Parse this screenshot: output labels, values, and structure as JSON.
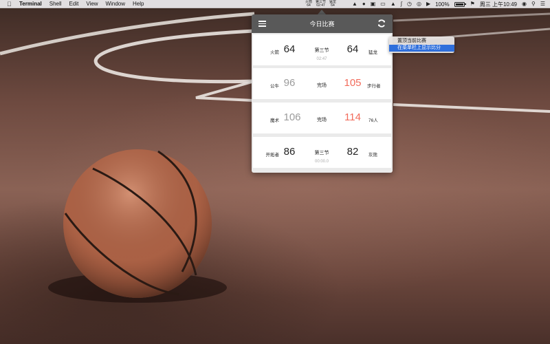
{
  "menubar": {
    "apple_icon": "apple-icon",
    "app_name": "Terminal",
    "menus": [
      "Shell",
      "Edit",
      "View",
      "Window",
      "Help"
    ],
    "mini_score": {
      "home_team": "火箭",
      "home_score": "64",
      "period": "第三节",
      "clock": "02:47",
      "away_team": "猛龙",
      "away_score": "64"
    },
    "battery_percent": "100%",
    "datetime": "周三 上午10:49"
  },
  "popover": {
    "title": "今日比赛",
    "menu_icon": "hamburger-menu-icon",
    "refresh_icon": "refresh-icon",
    "games": [
      {
        "home_team": "火箭",
        "home_score": "64",
        "state": "第三节",
        "clock": "02:47",
        "away_score": "64",
        "away_team": "猛龙"
      },
      {
        "home_team": "公牛",
        "home_score": "96",
        "state": "完场",
        "clock": "",
        "away_score": "105",
        "away_team": "步行者"
      },
      {
        "home_team": "魔术",
        "home_score": "106",
        "state": "完场",
        "clock": "",
        "away_score": "114",
        "away_team": "76人"
      },
      {
        "home_team": "开拓者",
        "home_score": "86",
        "state": "第三节",
        "clock": "00:00.0",
        "away_score": "82",
        "away_team": "灰熊"
      }
    ]
  },
  "context_menu": {
    "items": [
      "置顶当前比赛",
      "在菜单栏上显示比分"
    ],
    "selected_index": 1
  },
  "colors": {
    "header_bg": "#595959",
    "winner_score": "#f26b5b",
    "loser_score": "#9b9b9b",
    "selection": "#2f6fdc"
  }
}
